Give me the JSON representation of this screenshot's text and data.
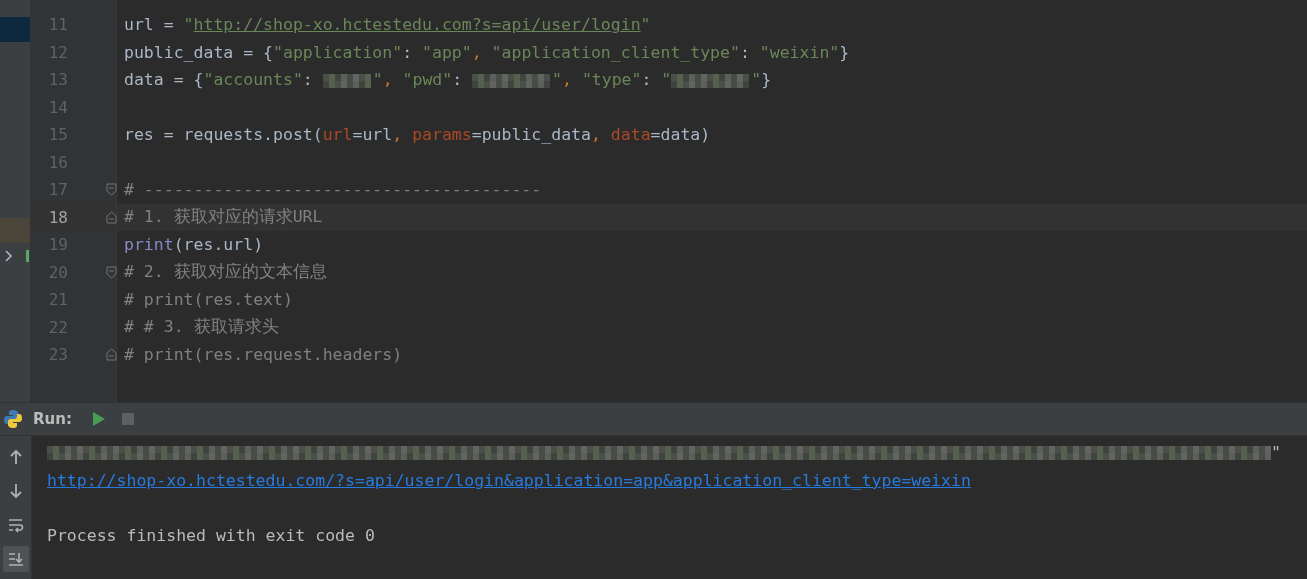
{
  "editor": {
    "lines": [
      {
        "number": "11",
        "current": false,
        "kind": "plain",
        "tokens": [
          {
            "kind": "plain",
            "text": "url = "
          },
          {
            "kind": "string",
            "text": "\""
          },
          {
            "kind": "url",
            "text": "http://shop-xo.hctestedu.com?s=api/user/login"
          },
          {
            "kind": "string",
            "text": "\""
          }
        ]
      },
      {
        "number": "12",
        "current": false,
        "kind": "plain",
        "tokens": [
          {
            "kind": "plain",
            "text": "public_data = {"
          },
          {
            "kind": "string",
            "text": "\"application\""
          },
          {
            "kind": "plain",
            "text": ": "
          },
          {
            "kind": "string",
            "text": "\"app\""
          },
          {
            "kind": "comma",
            "text": ", "
          },
          {
            "kind": "string",
            "text": "\"application_client_type\""
          },
          {
            "kind": "plain",
            "text": ": "
          },
          {
            "kind": "string",
            "text": "\"weixin\""
          },
          {
            "kind": "plain",
            "text": "}"
          }
        ]
      },
      {
        "number": "13",
        "current": false,
        "kind": "plain",
        "tokens": [
          {
            "kind": "plain",
            "text": "data = {"
          },
          {
            "kind": "string",
            "text": "\"accounts\""
          },
          {
            "kind": "plain",
            "text": ": "
          },
          {
            "kind": "redacted"
          },
          {
            "kind": "string",
            "text": "\""
          },
          {
            "kind": "comma",
            "text": ", "
          },
          {
            "kind": "string",
            "text": "\"pwd\""
          },
          {
            "kind": "plain",
            "text": ": "
          },
          {
            "kind": "redacted"
          },
          {
            "kind": "string",
            "text": "\""
          },
          {
            "kind": "comma",
            "text": ", "
          },
          {
            "kind": "string",
            "text": "\"type\""
          },
          {
            "kind": "plain",
            "text": ": "
          },
          {
            "kind": "string",
            "text": "\""
          },
          {
            "kind": "redacted"
          },
          {
            "kind": "string",
            "text": "\""
          },
          {
            "kind": "plain",
            "text": "}"
          }
        ]
      },
      {
        "number": "14",
        "current": false,
        "kind": "plain"
      },
      {
        "number": "15",
        "current": false,
        "kind": "plain",
        "tokens": [
          {
            "kind": "plain",
            "text": "res = requests.post("
          },
          {
            "kind": "param",
            "text": "url"
          },
          {
            "kind": "plain",
            "text": "=url"
          },
          {
            "kind": "comma",
            "text": ", "
          },
          {
            "kind": "param",
            "text": "params"
          },
          {
            "kind": "plain",
            "text": "=public_data"
          },
          {
            "kind": "comma",
            "text": ", "
          },
          {
            "kind": "param",
            "text": "data"
          },
          {
            "kind": "plain",
            "text": "=data)"
          }
        ]
      },
      {
        "number": "16",
        "current": false,
        "kind": "plain"
      },
      {
        "number": "17",
        "current": false,
        "kind": "fold-start",
        "tokens": [
          {
            "kind": "comment",
            "text": "# ----------------------------------------"
          }
        ]
      },
      {
        "number": "18",
        "current": true,
        "kind": "fold-end",
        "tokens": [
          {
            "kind": "comment",
            "text": "# 1. 获取对应的请求URL"
          }
        ]
      },
      {
        "number": "19",
        "current": false,
        "kind": "plain",
        "tokens": [
          {
            "kind": "builtin",
            "text": "print"
          },
          {
            "kind": "plain",
            "text": "(res.url)"
          }
        ]
      },
      {
        "number": "20",
        "current": false,
        "kind": "fold-start",
        "tokens": [
          {
            "kind": "comment",
            "text": "# 2. 获取对应的文本信息"
          }
        ]
      },
      {
        "number": "21",
        "current": false,
        "kind": "plain",
        "tokens": [
          {
            "kind": "comment",
            "text": "# print(res.text)"
          }
        ]
      },
      {
        "number": "22",
        "current": false,
        "kind": "plain",
        "tokens": [
          {
            "kind": "comment",
            "text": "# # 3. 获取请求头"
          }
        ]
      },
      {
        "number": "23",
        "current": false,
        "kind": "fold-end",
        "tokens": [
          {
            "kind": "comment",
            "text": "# print(res.request.headers)"
          }
        ]
      }
    ]
  },
  "run_panel": {
    "title": "Run:",
    "actions": [
      {
        "kind": "run"
      },
      {
        "kind": "stop"
      }
    ],
    "tools": [
      {
        "kind": "up",
        "selected": false
      },
      {
        "kind": "down",
        "selected": false
      },
      {
        "kind": "wrap",
        "selected": false
      },
      {
        "kind": "scroll-end",
        "selected": true
      }
    ],
    "output": [
      {
        "kind": "redacted",
        "text": "\""
      },
      {
        "kind": "link",
        "text": "http://shop-xo.hctestedu.com/?s=api/user/login&application=app&application_client_type=weixin"
      },
      {
        "kind": "blank"
      },
      {
        "kind": "plain",
        "text": "Process finished with exit code 0"
      }
    ]
  }
}
